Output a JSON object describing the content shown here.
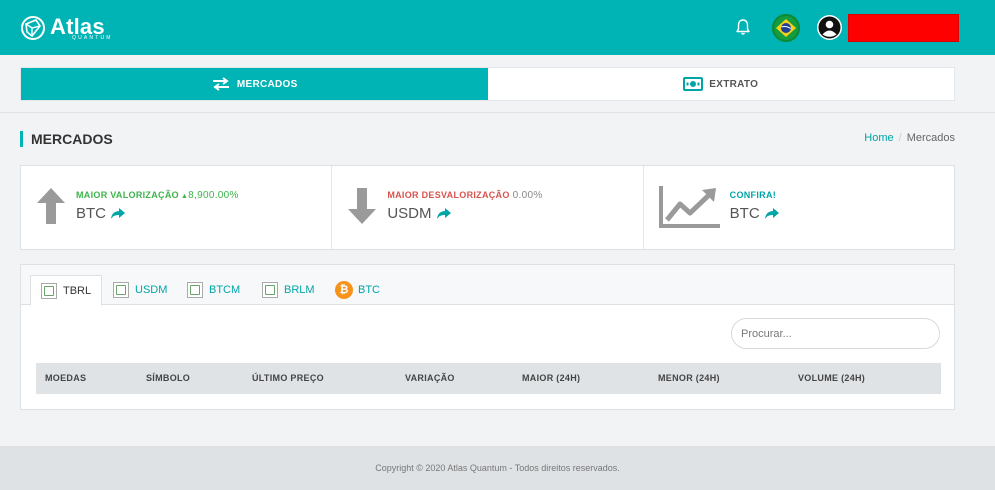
{
  "brand": {
    "name": "Atlas",
    "sub": "QUANTUM",
    "accent": "#00b3b5"
  },
  "header": {
    "icons": [
      "bell-icon",
      "brazil-flag-icon",
      "user-avatar-icon"
    ],
    "user_box_color": "#ff0000"
  },
  "main_tabs": [
    {
      "label": "MERCADOS",
      "icon": "exchange-arrows-icon",
      "active": true
    },
    {
      "label": "EXTRATO",
      "icon": "cash-icon",
      "active": false
    }
  ],
  "page": {
    "title": "MERCADOS",
    "breadcrumb": {
      "home": "Home",
      "separator": "/",
      "current": "Mercados"
    }
  },
  "stats": [
    {
      "label": "MAIOR VALORIZAÇÃO",
      "change": "8,900.00%",
      "change_prefix": "▲",
      "coin": "BTC",
      "icon": "arrow-up-icon",
      "color": "#3cb44b"
    },
    {
      "label": "MAIOR DESVALORIZAÇÃO",
      "change": "0.00%",
      "change_prefix": "",
      "coin": "USDM",
      "icon": "arrow-down-icon",
      "color": "#d9534f"
    },
    {
      "label": "CONFIRA!",
      "change": "",
      "change_prefix": "",
      "coin": "BTC",
      "icon": "trend-chart-icon",
      "color": "#00a5a8"
    }
  ],
  "coin_tabs": [
    {
      "label": "TBRL",
      "active": true
    },
    {
      "label": "USDM",
      "active": false
    },
    {
      "label": "BTCM",
      "active": false
    },
    {
      "label": "BRLM",
      "active": false
    },
    {
      "label": "BTC",
      "active": false
    }
  ],
  "search": {
    "placeholder": "Procurar...",
    "value": ""
  },
  "table": {
    "columns": [
      "MOEDAS",
      "SÍMBOLO",
      "ÚLTIMO PREÇO",
      "VARIAÇÃO",
      "MAIOR (24H)",
      "MENOR (24H)",
      "VOLUME (24H)"
    ],
    "rows": []
  },
  "footer": {
    "text": "Copyright © 2020 Atlas Quantum - Todos direitos reservados."
  }
}
